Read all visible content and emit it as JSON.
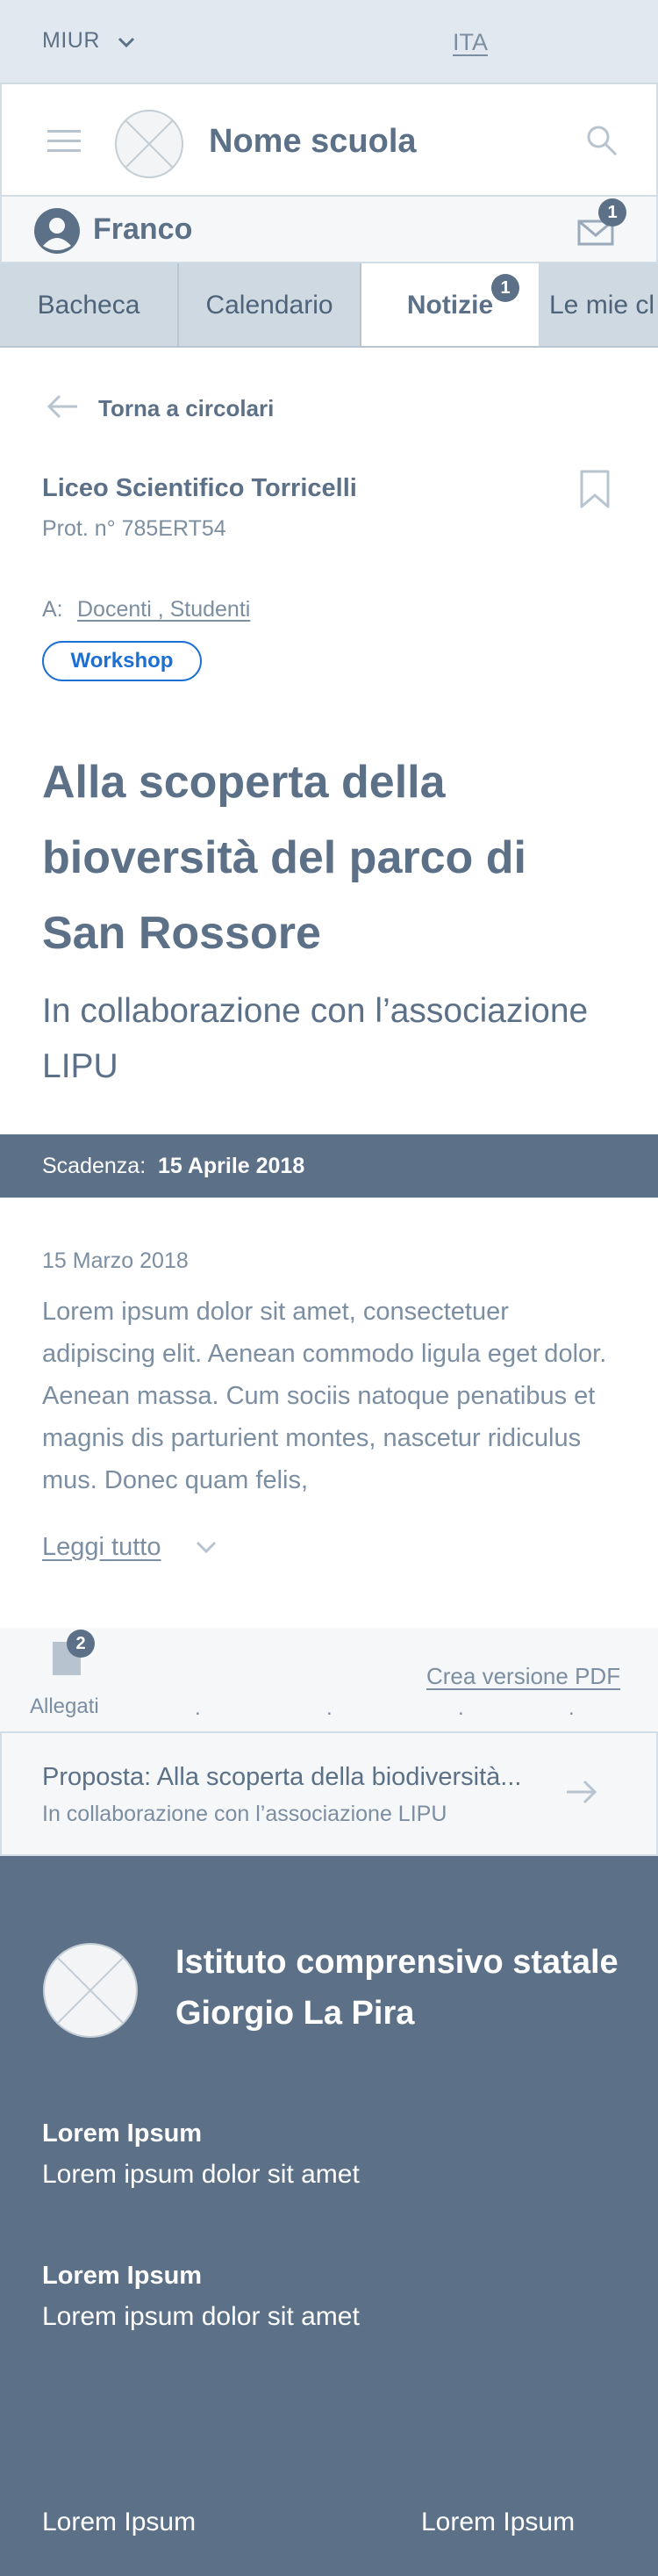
{
  "topbar": {
    "miur": "MIUR",
    "lang": "ITA"
  },
  "header": {
    "school_name": "Nome scuola"
  },
  "user": {
    "name": "Franco",
    "mail_count": "1"
  },
  "tabs": [
    {
      "label": "Bacheca"
    },
    {
      "label": "Calendario"
    },
    {
      "label": "Notizie",
      "badge": "1"
    },
    {
      "label": "Le mie cl"
    }
  ],
  "circular": {
    "back_label": "Torna a circolari",
    "sender": "Liceo Scientifico Torricelli",
    "protocol": "Prot. n° 785ERT54",
    "recipients_label": "A:",
    "recipients": "Docenti , Studenti",
    "tag": "Workshop",
    "title": "Alla scoperta della bioversità del parco di San Rossore",
    "subtitle": "In collaborazione con l’associazione LIPU",
    "deadline_label": "Scadenza:",
    "deadline_value": "15 Aprile 2018",
    "date": "15 Marzo 2018",
    "body": "Lorem ipsum dolor sit amet, consectetuer adipiscing elit. Aenean commodo ligula eget dolor. Aenean massa. Cum sociis natoque penatibus et magnis dis parturient montes, nascetur ridiculus mus. Donec quam felis,",
    "read_more": "Leggi tutto"
  },
  "attachments": {
    "count": "2",
    "label": "Allegati",
    "pdf_label": "Crea versione PDF",
    "dots": "."
  },
  "related": {
    "title": "Proposta: Alla scoperta della biodiversità...",
    "subtitle": "In collaborazione con l’associazione LIPU"
  },
  "footer": {
    "institute": "Istituto comprensivo statale Giorgio La Pira",
    "blocks": [
      {
        "heading": "Lorem Ipsum",
        "text": "Lorem ipsum dolor sit amet"
      },
      {
        "heading": "Lorem Ipsum",
        "text": "Lorem ipsum dolor sit amet"
      }
    ],
    "bottom_left": "Lorem Ipsum",
    "bottom_right": "Lorem Ipsum"
  },
  "colors": {
    "primary": "#5c7187",
    "accent": "#1c6fd3",
    "tab_bg": "#cfd9e2",
    "topbar_bg": "#e2e8ef"
  }
}
